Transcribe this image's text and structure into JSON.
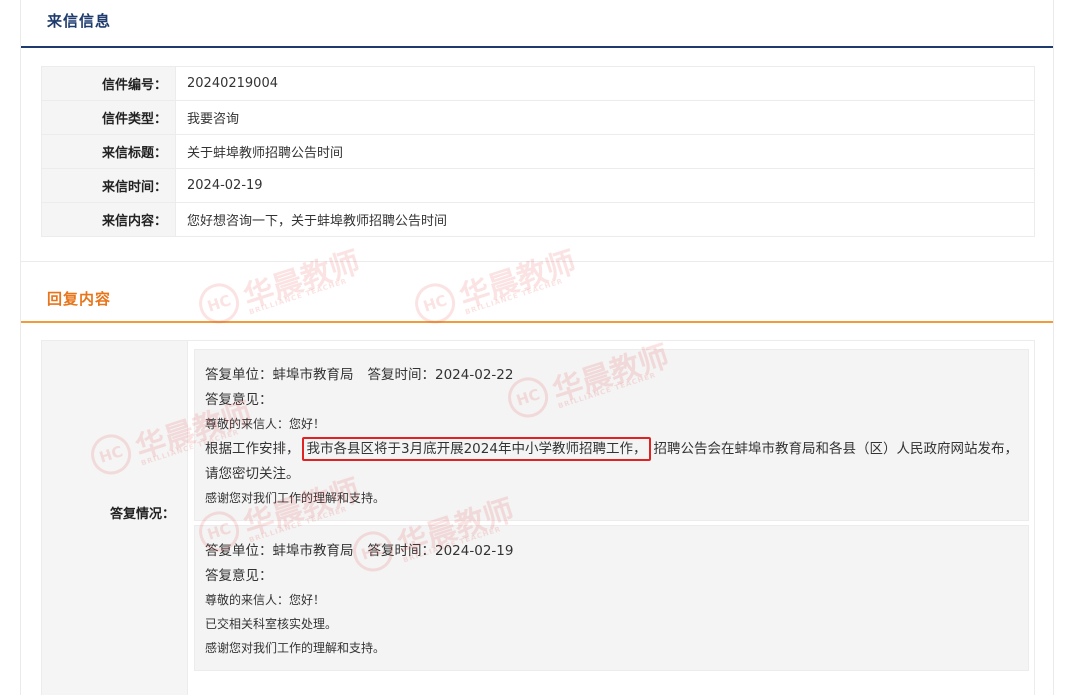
{
  "letter_section": {
    "title": "来信信息",
    "rows": [
      {
        "label": "信件编号：",
        "value": "20240219004"
      },
      {
        "label": "信件类型：",
        "value": "我要咨询"
      },
      {
        "label": "来信标题：",
        "value": "关于蚌埠教师招聘公告时间"
      },
      {
        "label": "来信时间：",
        "value": "2024-02-19"
      },
      {
        "label": "来信内容：",
        "value": "您好想咨询一下，关于蚌埠教师招聘公告时间"
      }
    ]
  },
  "reply_section": {
    "title": "回复内容",
    "label": "答复情况：",
    "replies": [
      {
        "unit": "答复单位：蚌埠市教育局",
        "time": "答复时间：2024-02-22",
        "opinion_label": "答复意见：",
        "greeting": "尊敬的来信人：您好！",
        "body_prefix": "根据工作安排，",
        "body_highlight": "我市各县区将于3月底开展2024年中小学教师招聘工作，",
        "body_suffix": "招聘公告会在蚌埠市教育局和各县（区）人民政府网站发布，",
        "body_line2": "请您密切关注。",
        "thanks": "感谢您对我们工作的理解和支持。"
      },
      {
        "unit": "答复单位：蚌埠市教育局",
        "time": "答复时间：2024-02-19",
        "opinion_label": "答复意见：",
        "greeting": "尊敬的来信人：您好！",
        "body": "已交相关科室核实处理。",
        "thanks": "感谢您对我们工作的理解和支持。"
      }
    ]
  },
  "watermark": {
    "logo_text": "HC",
    "text": "华晨教师",
    "subtext": "BRILLIANCE TEACHER"
  },
  "colors": {
    "letter_accent": "#1f3b6d",
    "reply_accent": "#e8751a",
    "highlight_border": "#e02222"
  }
}
